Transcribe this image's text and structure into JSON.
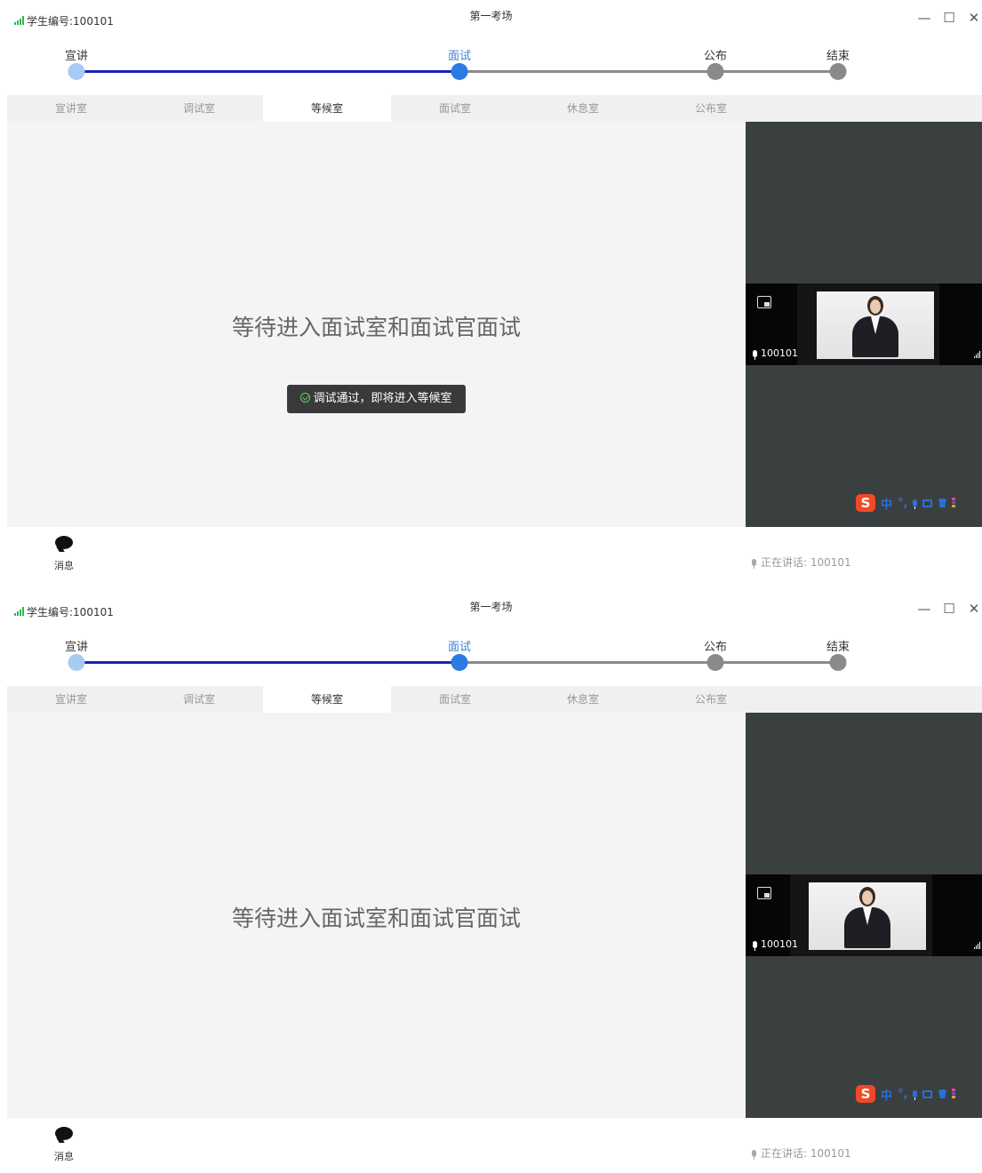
{
  "screens": [
    {
      "student_id": "学生编号:100101",
      "window_title": "第一考场",
      "window_controls": {
        "minimize": "—",
        "maximize": "☐",
        "close": "✕"
      },
      "steps": [
        {
          "label": "宣讲",
          "state": "done"
        },
        {
          "label": "面试",
          "state": "current"
        },
        {
          "label": "公布",
          "state": "todo"
        },
        {
          "label": "结束",
          "state": "todo"
        }
      ],
      "tabs": [
        {
          "label": "宣讲室",
          "active": false
        },
        {
          "label": "调试室",
          "active": false
        },
        {
          "label": "等候室",
          "active": true
        },
        {
          "label": "面试室",
          "active": false
        },
        {
          "label": "休息室",
          "active": false
        },
        {
          "label": "公布室",
          "active": false
        }
      ],
      "wait_message": "等待进入面试室和面试官面试",
      "toast": "调试通过，即将进入等候室",
      "video": {
        "participant_id": "100101"
      },
      "ime": {
        "lang": "中",
        "punct": "°,"
      },
      "message_label": "消息",
      "speaking": "正在讲话: 100101"
    },
    {
      "student_id": "学生编号:100101",
      "window_title": "第一考场",
      "window_controls": {
        "minimize": "—",
        "maximize": "☐",
        "close": "✕"
      },
      "steps": [
        {
          "label": "宣讲",
          "state": "done"
        },
        {
          "label": "面试",
          "state": "current"
        },
        {
          "label": "公布",
          "state": "todo"
        },
        {
          "label": "结束",
          "state": "todo"
        }
      ],
      "tabs": [
        {
          "label": "宣讲室",
          "active": false
        },
        {
          "label": "调试室",
          "active": false
        },
        {
          "label": "等候室",
          "active": true
        },
        {
          "label": "面试室",
          "active": false
        },
        {
          "label": "休息室",
          "active": false
        },
        {
          "label": "公布室",
          "active": false
        }
      ],
      "wait_message": "等待进入面试室和面试官面试",
      "video": {
        "participant_id": "100101"
      },
      "ime": {
        "lang": "中",
        "punct": "°,"
      },
      "message_label": "消息",
      "speaking": "正在讲话: 100101"
    }
  ],
  "colors": {
    "step_done": "#a7cbf3",
    "step_current": "#2a7be3",
    "step_todo": "#8a8a8a",
    "progress_line": "#1a22b5",
    "signal_green": "#2db84d",
    "ime_red": "#f04a24",
    "ime_blue": "#2a6fd6"
  }
}
